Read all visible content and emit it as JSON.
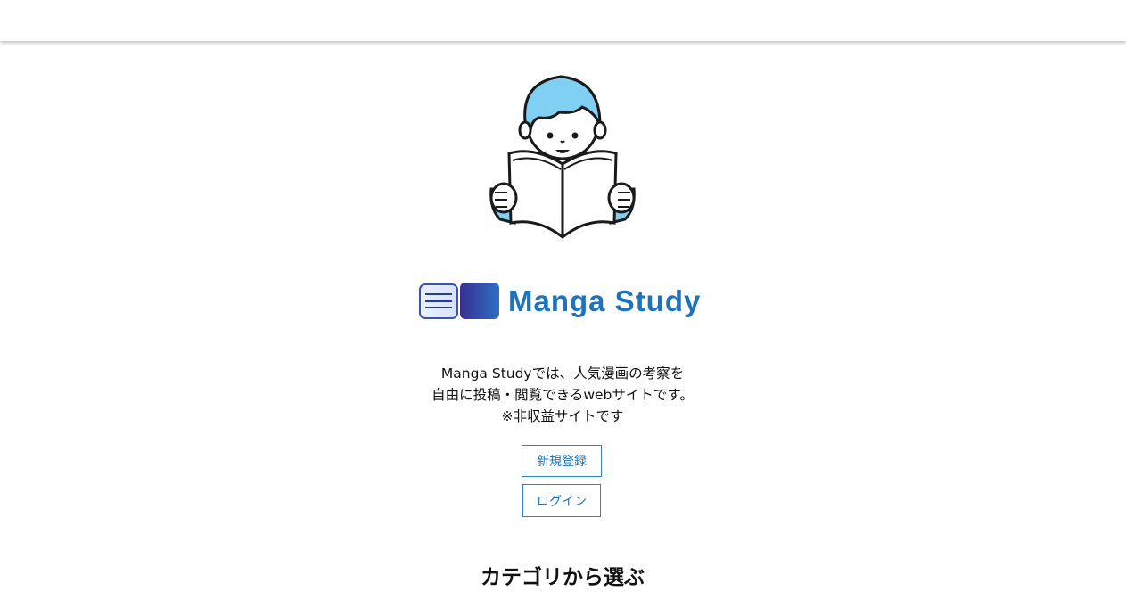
{
  "header": {},
  "hero": {
    "illustration_icon": "boy-reading-manga-illustration"
  },
  "brand": {
    "menu_icon": "hamburger-menu-icon",
    "logo_text": "Manga Study",
    "colors": {
      "logo_text": "#1d73bd",
      "logo_gradient_start": "#3a2f93",
      "logo_gradient_end": "#2c6fc4"
    }
  },
  "intro": {
    "line1": "Manga Studyでは、人気漫画の考察を",
    "line2": "自由に投稿・閲覧できるwebサイトです。",
    "line3": "※非収益サイトです"
  },
  "actions": {
    "register_label": "新規登録",
    "login_label": "ログイン",
    "accent_color": "#2d84c7"
  },
  "categories": {
    "title": "カテゴリから選ぶ"
  }
}
